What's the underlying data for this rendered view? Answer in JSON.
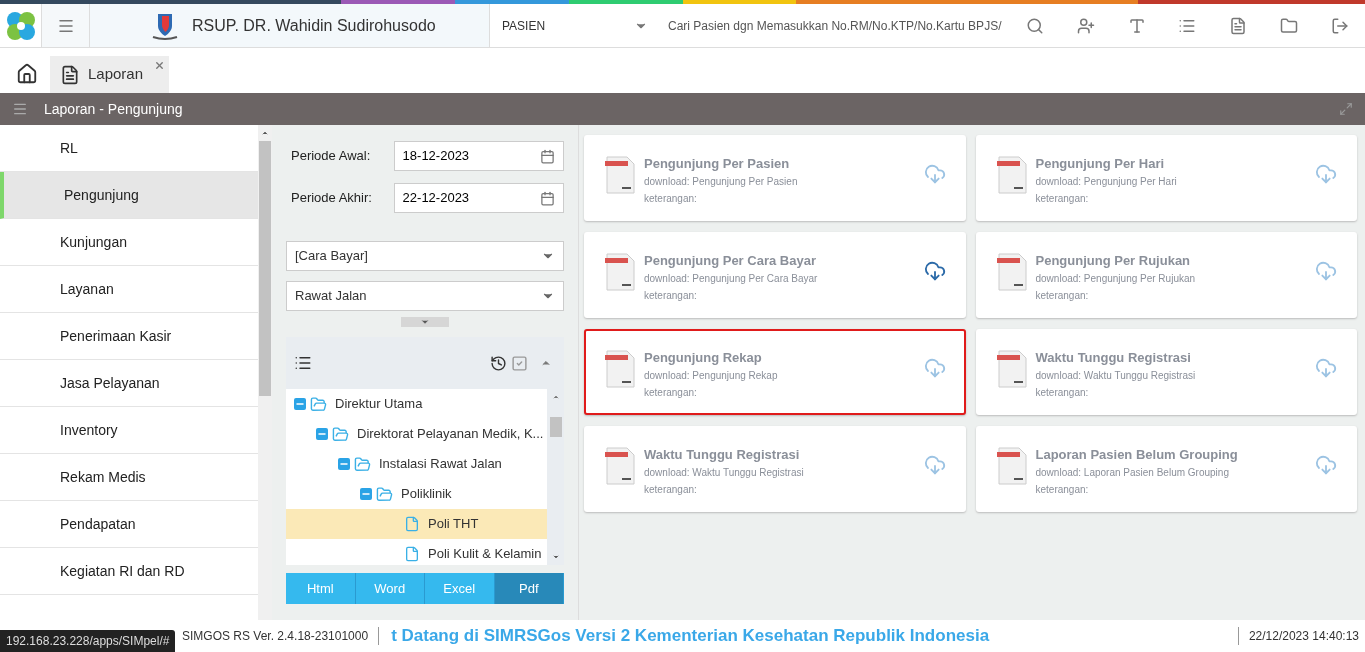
{
  "header": {
    "hospital": "RSUP. DR. Wahidin Sudirohusodo",
    "category": "PASIEN",
    "search_placeholder": "Cari Pasien dgn Memasukkan No.RM/No.KTP/No.Kartu BPJS/"
  },
  "tabs": [
    {
      "label": "Laporan",
      "selected": true
    }
  ],
  "panel_title": "Laporan - Pengunjung",
  "sidebar": {
    "items": [
      {
        "label": "RL",
        "selected": false
      },
      {
        "label": "Pengunjung",
        "selected": true
      },
      {
        "label": "Kunjungan",
        "selected": false
      },
      {
        "label": "Layanan",
        "selected": false
      },
      {
        "label": "Penerimaan Kasir",
        "selected": false
      },
      {
        "label": "Jasa Pelayanan",
        "selected": false
      },
      {
        "label": "Inventory",
        "selected": false
      },
      {
        "label": "Rekam Medis",
        "selected": false
      },
      {
        "label": "Pendapatan",
        "selected": false
      },
      {
        "label": "Kegiatan RI dan RD",
        "selected": false
      }
    ]
  },
  "filters": {
    "dates": [
      {
        "label": "Periode Awal:",
        "value": "18-12-2023"
      },
      {
        "label": "Periode Akhir:",
        "value": "22-12-2023"
      }
    ],
    "selects": [
      {
        "value": "[Cara Bayar]"
      },
      {
        "value": "Rawat Jalan"
      }
    ]
  },
  "tree": [
    {
      "label": "Direktur Utama",
      "expanded": true,
      "selected": false,
      "children": [
        {
          "label": "Direktorat Pelayanan Medik, K...",
          "expanded": true,
          "selected": false,
          "children": [
            {
              "label": "Instalasi Rawat Jalan",
              "expanded": true,
              "selected": false,
              "children": [
                {
                  "label": "Poliklinik",
                  "expanded": true,
                  "selected": false,
                  "children": [
                    {
                      "label": "Poli THT",
                      "selected": true
                    },
                    {
                      "label": "Poli Kulit & Kelamin",
                      "selected": false
                    }
                  ]
                }
              ]
            }
          ]
        }
      ]
    }
  ],
  "export_buttons": [
    {
      "label": "Html",
      "selected": false
    },
    {
      "label": "Word",
      "selected": false
    },
    {
      "label": "Excel",
      "selected": false
    },
    {
      "label": "Pdf",
      "selected": true
    }
  ],
  "reports": [
    {
      "title": "Pengunjung Per Pasien",
      "download": "download: Pengunjung Per Pasien",
      "note": "keterangan:",
      "selected": false,
      "hovered": false
    },
    {
      "title": "Pengunjung Per Hari",
      "download": "download: Pengunjung Per Hari",
      "note": "keterangan:",
      "selected": false,
      "hovered": false
    },
    {
      "title": "Pengunjung Per Cara Bayar",
      "download": "download: Pengunjung Per Cara Bayar",
      "note": "keterangan:",
      "selected": false,
      "hovered": true
    },
    {
      "title": "Pengunjung Per Rujukan",
      "download": "download: Pengunjung Per Rujukan",
      "note": "keterangan:",
      "selected": false,
      "hovered": false
    },
    {
      "title": "Pengunjung Rekap",
      "download": "download: Pengunjung Rekap",
      "note": "keterangan:",
      "selected": true,
      "hovered": false
    },
    {
      "title": "Waktu Tunggu Registrasi",
      "download": "download: Waktu Tunggu Registrasi",
      "note": "keterangan:",
      "selected": false,
      "hovered": false
    },
    {
      "title": "Waktu Tunggu Registrasi",
      "download": "download: Waktu Tunggu Registrasi",
      "note": "keterangan:",
      "selected": false,
      "hovered": false
    },
    {
      "title": "Laporan Pasien Belum Grouping",
      "download": "download: Laporan Pasien Belum Grouping",
      "note": "keterangan:",
      "selected": false,
      "hovered": false
    }
  ],
  "footer": {
    "version": "SIMGOS RS Ver. 2.4.18-23101000",
    "marquee": "t Datang di SIMRSGos Versi 2 Kementerian Kesehatan Republik Indonesia",
    "datetime": "22/12/2023 14:40:13",
    "link_preview": "192.168.23.228/apps/SIMpel/#"
  }
}
